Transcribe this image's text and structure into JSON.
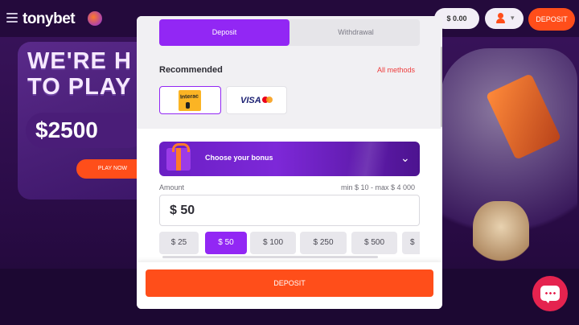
{
  "site": {
    "brand": "tonybet",
    "balance": "$ 0.00",
    "top_deposit_label": "DEPOSIT",
    "banner": {
      "line1": "WE'RE H",
      "line2": "TO PLAY",
      "amount": "$2500",
      "button": "PLAY NOW"
    }
  },
  "modal": {
    "tabs": [
      {
        "label": "Deposit",
        "active": true
      },
      {
        "label": "Withdrawal",
        "active": false
      }
    ],
    "recommended_title": "Recommended",
    "all_methods_link": "All methods",
    "payment_methods": [
      {
        "name": "interac-logo",
        "label": "Interac",
        "selected": true
      },
      {
        "name": "visa-mastercard-logo",
        "label": "VISA",
        "selected": false
      }
    ],
    "bonus_label": "Choose your bonus",
    "amount": {
      "label": "Amount",
      "range": "min $ 10 - max $ 4 000",
      "value": "$ 50"
    },
    "quick_amounts": [
      {
        "label": "$ 25",
        "active": false
      },
      {
        "label": "$ 50",
        "active": true
      },
      {
        "label": "$ 100",
        "active": false
      },
      {
        "label": "$ 250",
        "active": false
      },
      {
        "label": "$ 500",
        "active": false
      },
      {
        "label": "$",
        "active": false
      }
    ],
    "deposit_button": "DEPOSIT"
  },
  "colors": {
    "accent_purple": "#9227f4",
    "cta_orange": "#ff4e1a",
    "link_red": "#ee3b3b",
    "chat_red": "#e5234f"
  },
  "icons": [
    "menu-icon",
    "user-icon",
    "chevron-down-icon",
    "gift-icon",
    "chat-icon"
  ]
}
